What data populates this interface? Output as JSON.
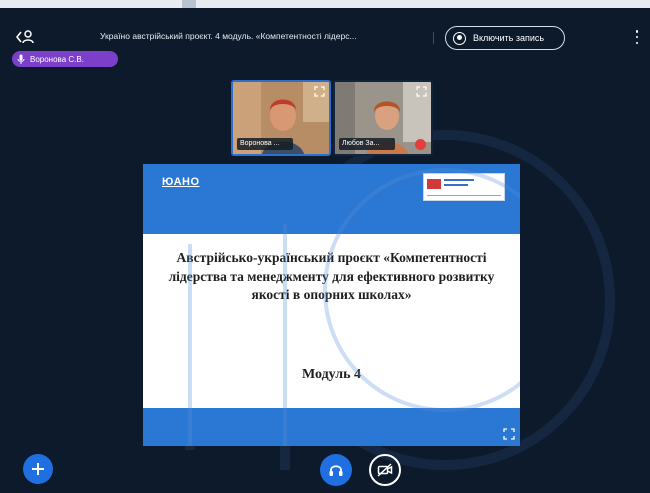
{
  "topbar": {
    "meeting_title": "Україно австрійський проєкт. 4 модуль. «Компетентності лідерс...",
    "record_label": "Включить запись",
    "users_icon": "users-icon",
    "options_icon": "kebab-icon"
  },
  "talking_indicator": {
    "name": "Воронова С.В.",
    "icon": "microphone-icon",
    "color": "#7b3fc9"
  },
  "videos": [
    {
      "name": "Воронова ...",
      "icon": "fullscreen-icon"
    },
    {
      "name": "Любов За...",
      "icon": "fullscreen-icon",
      "status_icon": "muted-mic-icon"
    }
  ],
  "presentation": {
    "logo": "ЮАНО",
    "title": "Австрійсько-український проєкт «Компетентності лідерства та менеджменту для ефективного розвитку якості в опорних школах»",
    "module": "Модуль 4",
    "accent_color": "#2a78d4"
  },
  "action_bar": {
    "actions_icon": "plus-icon",
    "audio_icon": "headphones-icon",
    "video_icon": "camera-off-icon",
    "button_color": "#1f6fe0"
  },
  "colors": {
    "background": "#0d1a2b"
  }
}
